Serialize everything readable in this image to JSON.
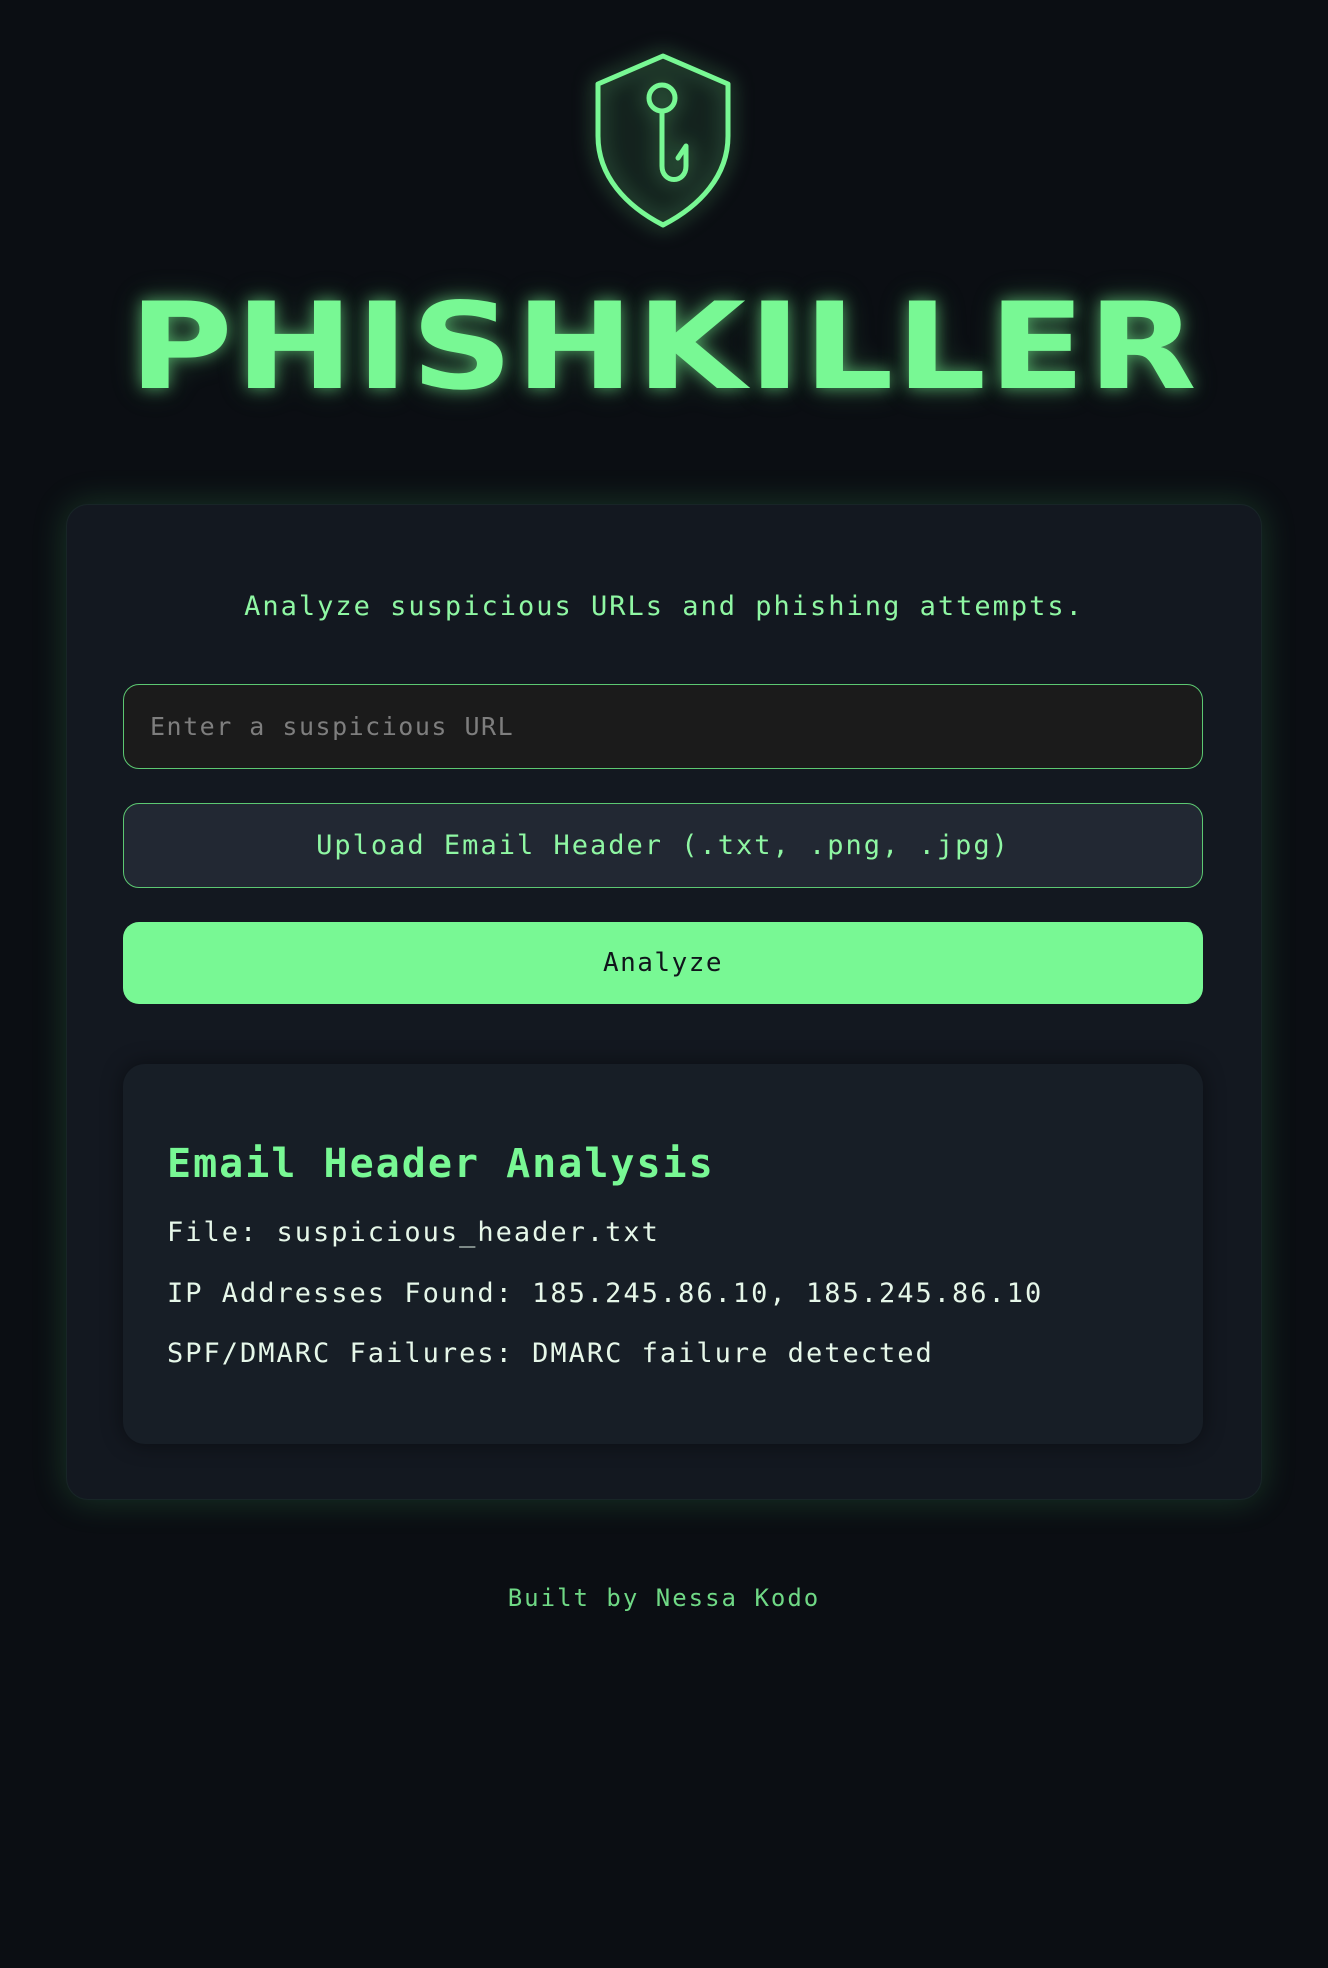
{
  "app": {
    "title": "PHISHKILLER",
    "logo_icon": "shield-hook-icon",
    "accent_color": "#78f894",
    "background_color": "#0b0e13"
  },
  "main": {
    "tagline": "Analyze suspicious URLs and phishing attempts.",
    "url_input": {
      "placeholder": "Enter a suspicious URL",
      "value": ""
    },
    "upload_label": "Upload Email Header (.txt, .png, .jpg)",
    "analyze_label": "Analyze"
  },
  "result": {
    "title": "Email Header Analysis",
    "file_line": "File: suspicious_header.txt",
    "ip_line": "IP Addresses Found: 185.245.86.10, 185.245.86.10",
    "spf_line": "SPF/DMARC Failures: DMARC failure detected"
  },
  "footer": {
    "text": "Built by Nessa Kodo"
  }
}
